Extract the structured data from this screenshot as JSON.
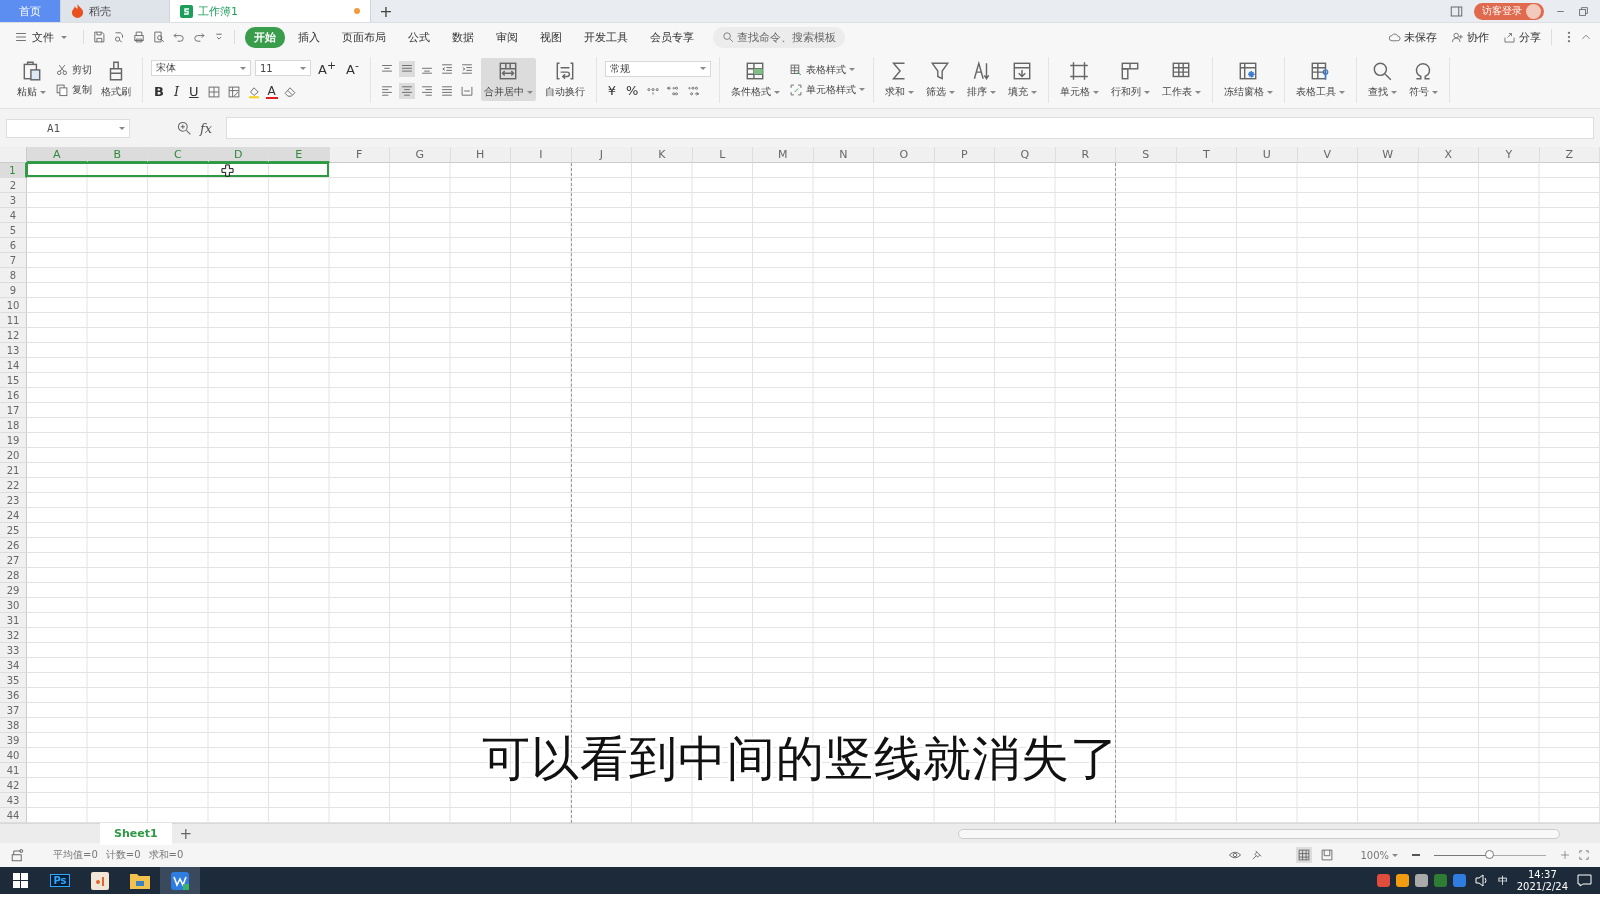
{
  "title_bar": {
    "tabs": [
      {
        "label": "首页",
        "kind": "home",
        "selected": false
      },
      {
        "label": "稻壳",
        "kind": "docer",
        "selected": false
      },
      {
        "label": "工作簿1",
        "kind": "sheet",
        "selected": true,
        "unsaved": true
      }
    ],
    "new_tab": "+",
    "login": "访客登录"
  },
  "menu": {
    "file": "文件",
    "tabs": [
      {
        "label": "开始",
        "selected": true
      },
      {
        "label": "插入",
        "selected": false
      },
      {
        "label": "页面布局",
        "selected": false
      },
      {
        "label": "公式",
        "selected": false
      },
      {
        "label": "数据",
        "selected": false
      },
      {
        "label": "审阅",
        "selected": false
      },
      {
        "label": "视图",
        "selected": false
      },
      {
        "label": "开发工具",
        "selected": false
      },
      {
        "label": "会员专享",
        "selected": false
      }
    ],
    "search": {
      "placeholder": "查找命令、搜索模板"
    },
    "actions": [
      "未保存",
      "协作",
      "分享"
    ]
  },
  "ribbon": {
    "clipboard": {
      "paste": "粘贴",
      "cut": "剪切",
      "copy": "复制",
      "format_painter": "格式刷"
    },
    "font": {
      "name": "宋体",
      "size": "11",
      "grow": "A$^{+}$",
      "shrink": "A$^{-}$",
      "styles": [
        "B",
        "I",
        "U"
      ],
      "color_button": "A"
    },
    "alignment": {
      "merge": "合并居中",
      "wrap": "自动换行"
    },
    "number": {
      "format": "常规",
      "currency": "¥",
      "percent": "%"
    },
    "styles": {
      "conditional": "条件格式",
      "table_style": "表格样式",
      "cell_style": "单元格样式"
    },
    "tool_groups": [
      [
        "求和",
        "筛选",
        "排序",
        "填充"
      ],
      [
        "单元格",
        "行和列",
        "工作表"
      ],
      [
        "冻结窗格"
      ],
      [
        "表格工具"
      ],
      [
        "查找",
        "符号"
      ]
    ]
  },
  "formula_bar": {
    "name_box": "A1",
    "fx": "fx"
  },
  "sheet": {
    "columns": [
      {
        "label": "A",
        "selected": true,
        "page_break": false
      },
      {
        "label": "B",
        "selected": true,
        "page_break": false
      },
      {
        "label": "C",
        "selected": true,
        "page_break": false
      },
      {
        "label": "D",
        "selected": true,
        "page_break": false
      },
      {
        "label": "E",
        "selected": true,
        "page_break": false
      },
      {
        "label": "F",
        "selected": false,
        "page_break": false
      },
      {
        "label": "G",
        "selected": false,
        "page_break": false
      },
      {
        "label": "H",
        "selected": false,
        "page_break": false
      },
      {
        "label": "I",
        "selected": false,
        "page_break": true
      },
      {
        "label": "J",
        "selected": false,
        "page_break": false
      },
      {
        "label": "K",
        "selected": false,
        "page_break": false
      },
      {
        "label": "L",
        "selected": false,
        "page_break": false
      },
      {
        "label": "M",
        "selected": false,
        "page_break": false
      },
      {
        "label": "N",
        "selected": false,
        "page_break": false
      },
      {
        "label": "O",
        "selected": false,
        "page_break": false
      },
      {
        "label": "P",
        "selected": false,
        "page_break": false
      },
      {
        "label": "Q",
        "selected": false,
        "page_break": false
      },
      {
        "label": "R",
        "selected": false,
        "page_break": true
      },
      {
        "label": "S",
        "selected": false,
        "page_break": false
      },
      {
        "label": "T",
        "selected": false,
        "page_break": false
      },
      {
        "label": "U",
        "selected": false,
        "page_break": false
      },
      {
        "label": "V",
        "selected": false,
        "page_break": false
      },
      {
        "label": "W",
        "selected": false,
        "page_break": false
      },
      {
        "label": "X",
        "selected": false,
        "page_break": false
      },
      {
        "label": "Y",
        "selected": false,
        "page_break": false
      },
      {
        "label": "Z",
        "selected": false,
        "page_break": false
      }
    ],
    "rows": [
      {
        "label": "1",
        "selected": true
      },
      {
        "label": "2",
        "selected": false
      },
      {
        "label": "3",
        "selected": false
      },
      {
        "label": "4",
        "selected": false
      },
      {
        "label": "5",
        "selected": false
      },
      {
        "label": "6",
        "selected": false
      },
      {
        "label": "7",
        "selected": false
      },
      {
        "label": "8",
        "selected": false
      },
      {
        "label": "9",
        "selected": false
      },
      {
        "label": "10",
        "selected": false
      },
      {
        "label": "11",
        "selected": false
      },
      {
        "label": "12",
        "selected": false
      },
      {
        "label": "13",
        "selected": false
      },
      {
        "label": "14",
        "selected": false
      },
      {
        "label": "15",
        "selected": false
      },
      {
        "label": "16",
        "selected": false
      },
      {
        "label": "17",
        "selected": false
      },
      {
        "label": "18",
        "selected": false
      },
      {
        "label": "19",
        "selected": false
      },
      {
        "label": "20",
        "selected": false
      },
      {
        "label": "21",
        "selected": false
      },
      {
        "label": "22",
        "selected": false
      },
      {
        "label": "23",
        "selected": false
      },
      {
        "label": "24",
        "selected": false
      },
      {
        "label": "25",
        "selected": false
      },
      {
        "label": "26",
        "selected": false
      },
      {
        "label": "27",
        "selected": false
      },
      {
        "label": "28",
        "selected": false
      },
      {
        "label": "29",
        "selected": false
      },
      {
        "label": "30",
        "selected": false
      },
      {
        "label": "31",
        "selected": false
      },
      {
        "label": "32",
        "selected": false
      },
      {
        "label": "33",
        "selected": false
      },
      {
        "label": "34",
        "selected": false
      },
      {
        "label": "35",
        "selected": false
      },
      {
        "label": "36",
        "selected": false
      },
      {
        "label": "37",
        "selected": false
      },
      {
        "label": "38",
        "selected": false
      },
      {
        "label": "39",
        "selected": false
      },
      {
        "label": "40",
        "selected": false
      },
      {
        "label": "41",
        "selected": false
      },
      {
        "label": "42",
        "selected": false
      },
      {
        "label": "43",
        "selected": false
      },
      {
        "label": "44",
        "selected": false
      }
    ]
  },
  "subtitle": "可以看到中间的竖线就消失了",
  "sheet_tabs": [
    {
      "label": "Sheet1",
      "selected": true
    }
  ],
  "add_sheet": "+",
  "status_bar": {
    "stats": [
      "平均值=0",
      "计数=0",
      "求和=0"
    ],
    "zoom": "100%",
    "zoom_slider": {
      "level": 0.5
    }
  },
  "taskbar": {
    "apps": [
      {
        "label": "Ps",
        "kind": "ps"
      },
      {
        "kind": "app"
      },
      {
        "kind": "folder"
      },
      {
        "kind": "wps"
      }
    ],
    "ime": "中",
    "time": "14:37",
    "date": "2021/2/24"
  }
}
